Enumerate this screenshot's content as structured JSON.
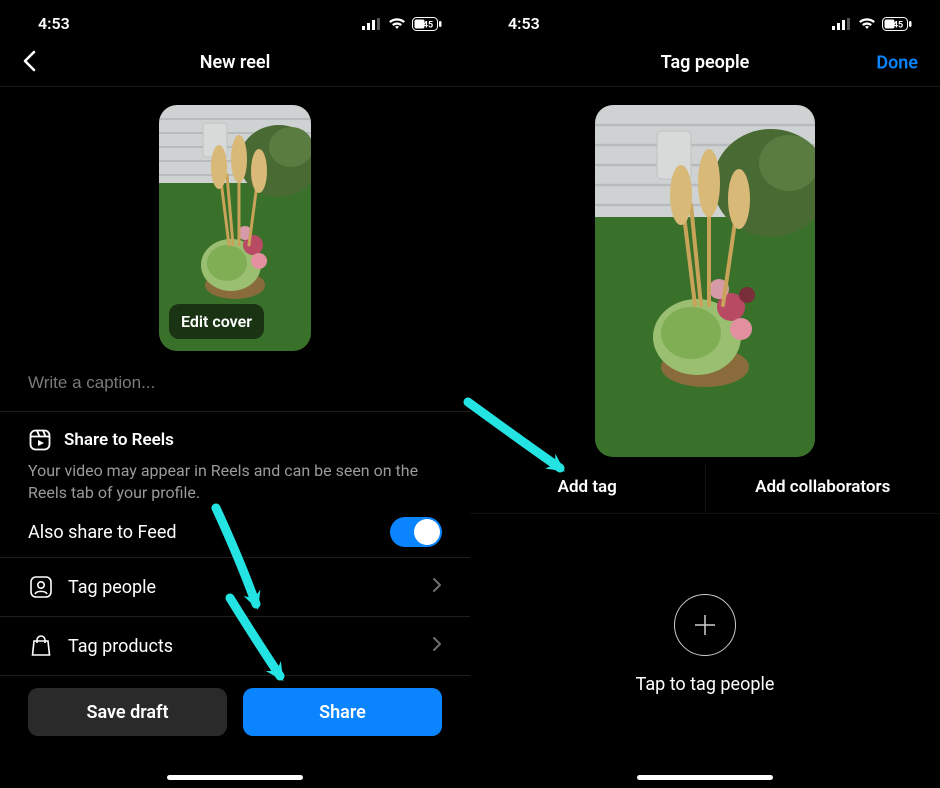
{
  "status": {
    "time": "4:53",
    "battery": "45"
  },
  "left": {
    "title": "New reel",
    "editCover": "Edit cover",
    "captionPlaceholder": "Write a caption...",
    "shareToReels": {
      "heading": "Share to Reels",
      "description": "Your video may appear in Reels and can be seen on the Reels tab of your profile.",
      "alsoFeed": "Also share to Feed"
    },
    "rows": {
      "tagPeople": "Tag people",
      "tagProducts": "Tag products"
    },
    "buttons": {
      "saveDraft": "Save draft",
      "share": "Share"
    }
  },
  "right": {
    "title": "Tag people",
    "done": "Done",
    "seg": {
      "addTag": "Add tag",
      "addCollab": "Add collaborators"
    },
    "tapLabel": "Tap to tag people"
  },
  "colors": {
    "accent": "#0a84ff",
    "arrow": "#24e3e3"
  }
}
